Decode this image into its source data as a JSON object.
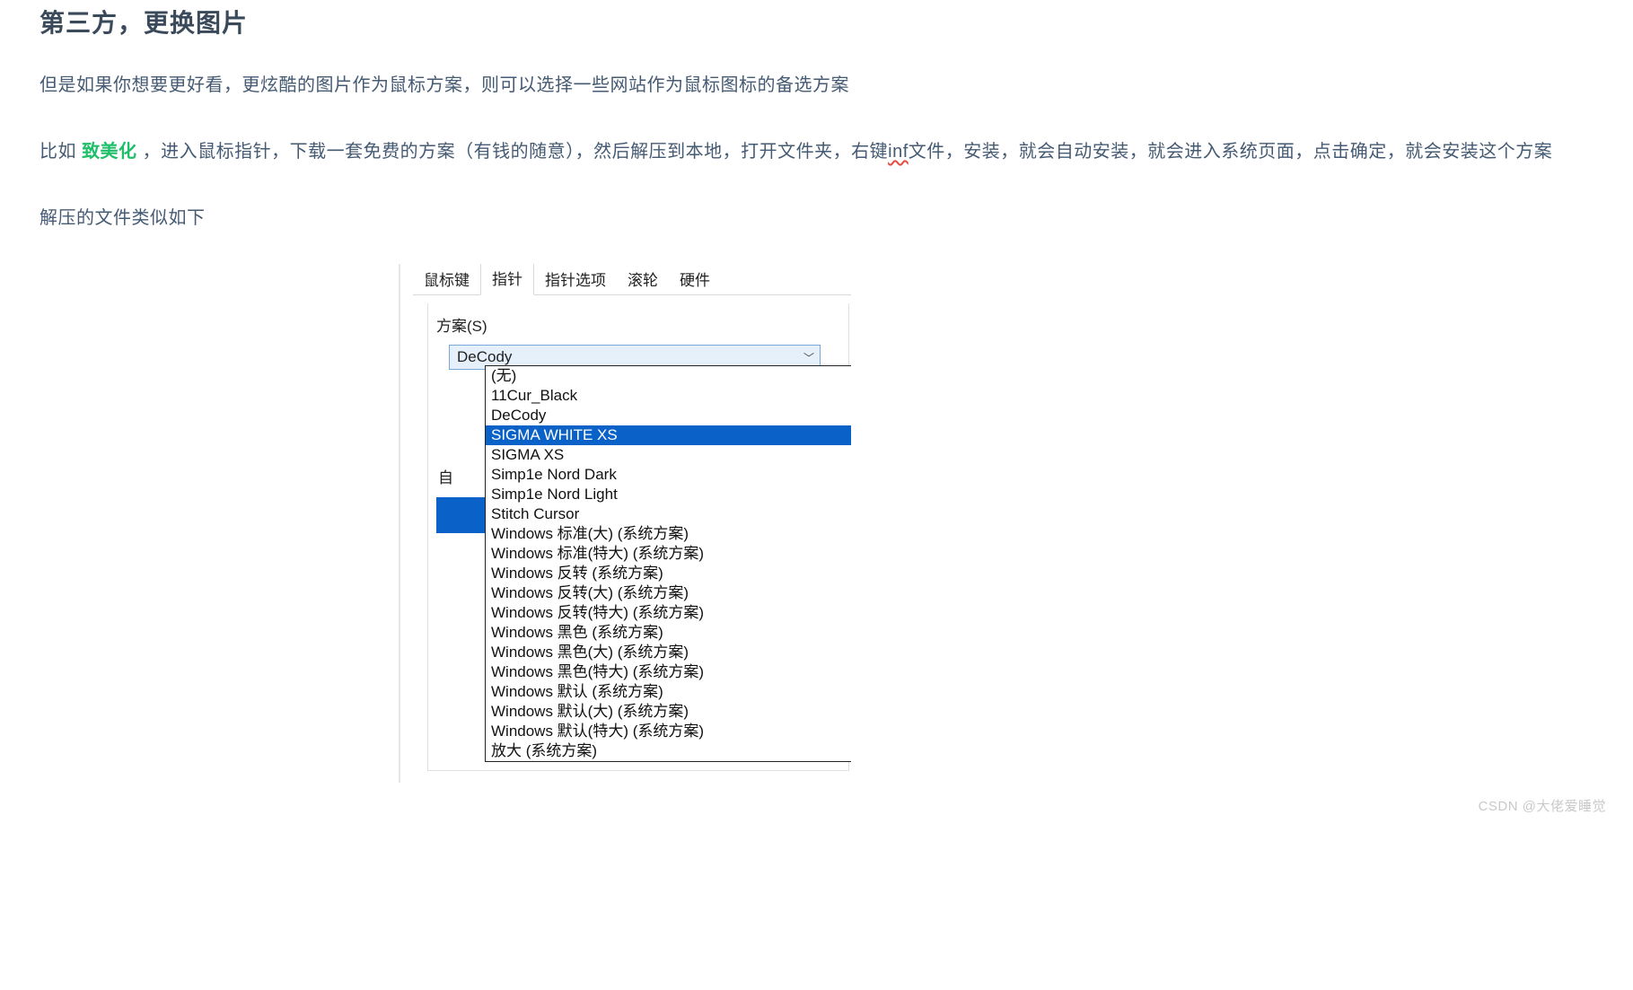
{
  "article": {
    "heading": "第三方，更换图片",
    "p1": "但是如果你想要更好看，更炫酷的图片作为鼠标方案，则可以选择一些网站作为鼠标图标的备选方案",
    "p2_pre": "比如 ",
    "p2_link": "致美化",
    "p2_mid1": " ，进入鼠标指针，下载一套免费的方案（有钱的随意），然后解压到本地，打开文件夹，右键",
    "p2_inf": "inf",
    "p2_mid2": "文件，安装，就会自动安装，就会进入系统页面，点击确定，就会安装这个方案",
    "p3": "解压的文件类似如下"
  },
  "dialog": {
    "tabs": [
      "鼠标键",
      "指针",
      "指针选项",
      "滚轮",
      "硬件"
    ],
    "active_tab_index": 1,
    "group_label": "方案(S)",
    "combo_value": "DeCody",
    "bg_label": "自",
    "options": [
      "(无)",
      "11Cur_Black",
      "DeCody",
      "SIGMA WHITE XS",
      "SIGMA XS",
      "Simp1e Nord Dark",
      "Simp1e Nord Light",
      "Stitch Cursor",
      "Windows 标准(大) (系统方案)",
      "Windows 标准(特大) (系统方案)",
      "Windows 反转 (系统方案)",
      "Windows 反转(大) (系统方案)",
      "Windows 反转(特大) (系统方案)",
      "Windows 黑色 (系统方案)",
      "Windows 黑色(大) (系统方案)",
      "Windows 黑色(特大) (系统方案)",
      "Windows 默认 (系统方案)",
      "Windows 默认(大) (系统方案)",
      "Windows 默认(特大) (系统方案)",
      "放大 (系统方案)"
    ],
    "highlight_index": 3
  },
  "watermark": "CSDN @大佬爱睡觉"
}
